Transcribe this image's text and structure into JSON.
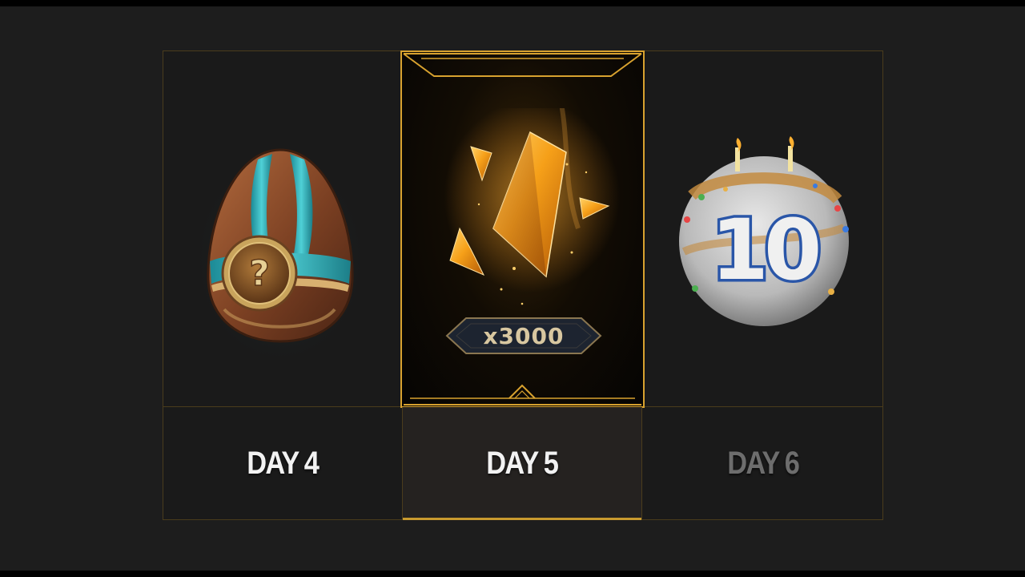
{
  "rewards": [
    {
      "day_label": "DAY 4",
      "icon": "mystery-egg-icon",
      "icon_glyph": "?",
      "selected": false,
      "available": true
    },
    {
      "day_label": "DAY 5",
      "icon": "amber-crystal-icon",
      "quantity_label": "x3000",
      "selected": true,
      "available": true
    },
    {
      "day_label": "DAY 6",
      "icon": "anniversary-cake-icon",
      "icon_number": "10",
      "selected": false,
      "available": false
    }
  ],
  "colors": {
    "background": "#1d1d1d",
    "accent_gold": "#d8a22f",
    "label_active": "#f2f2f2",
    "label_inactive": "#6d6d6d"
  }
}
